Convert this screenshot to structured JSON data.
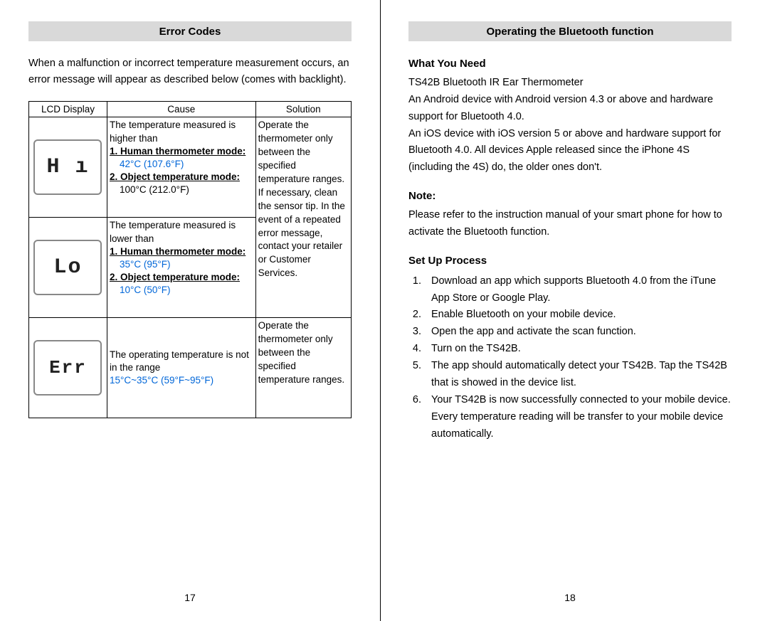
{
  "left": {
    "header": "Error Codes",
    "intro": "When a malfunction or incorrect temperature measurement occurs, an error message will appear as described below (comes with backlight).",
    "table": {
      "headers": {
        "lcd": "LCD Display",
        "cause": "Cause",
        "solution": "Solution"
      },
      "rows": [
        {
          "lcd": "H ı",
          "cause": {
            "lead": "The temperature measured is higher than",
            "m1_label": "1. Human thermometer mode:",
            "m1_val": "42°C (107.6°F)",
            "m2_label": "2. Object temperature mode:",
            "m2_val": "100°C (212.0°F)"
          }
        },
        {
          "lcd": "Lo",
          "cause": {
            "lead": "The temperature measured is lower than",
            "m1_label": "1. Human thermometer mode:",
            "m1_val": "35°C (95°F)",
            "m2_label": "2. Object temperature mode:",
            "m2_val": "10°C (50°F)"
          }
        },
        {
          "lcd": "Err",
          "cause": {
            "lead": "The operating temperature is not in the range",
            "val": "15°C~35°C (59°F~95°F)"
          },
          "solution": "Operate the thermometer only between the specified temperature ranges."
        }
      ],
      "solution_shared": "Operate the thermometer only between the specified temperature ranges. If necessary, clean the sensor tip. In the event of a repeated error message, contact your retailer or Customer Services."
    },
    "page_num": "17"
  },
  "right": {
    "header": "Operating the Bluetooth function",
    "need_h": "What You Need",
    "need_1": "TS42B Bluetooth IR Ear Thermometer",
    "need_2": "An Android device with Android version 4.3 or above and hardware support for Bluetooth 4.0.",
    "need_3": "An iOS device with iOS version 5 or above and hardware support for Bluetooth 4.0. All devices Apple released since the iPhone 4S (including the 4S) do, the older ones don't.",
    "note_h": "Note:",
    "note_body": "Please refer to the instruction manual of your smart phone for how to activate the Bluetooth function.",
    "setup_h": "Set Up Process",
    "steps": [
      "Download an app which supports Bluetooth 4.0 from the iTune App Store or Google Play.",
      "Enable Bluetooth on your mobile device.",
      "Open the app and activate the scan function.",
      "Turn on the TS42B.",
      "The app should automatically detect your TS42B. Tap the TS42B that is showed in the device list.",
      "Your TS42B is now successfully connected to your mobile device. Every temperature reading will be transfer to your mobile device automatically."
    ],
    "page_num": "18"
  }
}
